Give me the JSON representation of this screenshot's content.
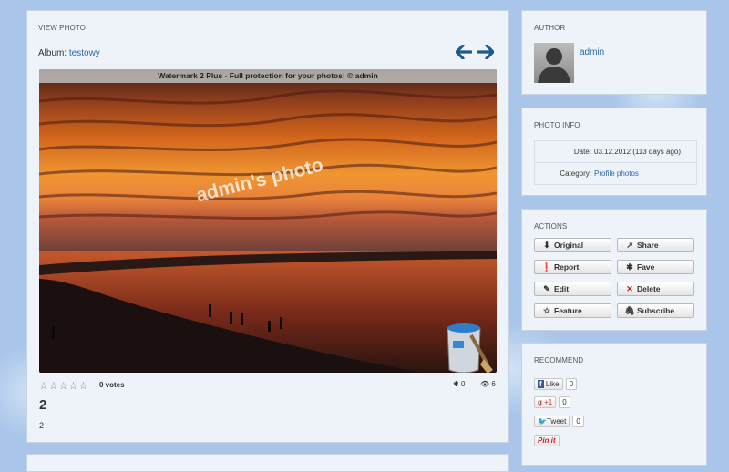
{
  "main": {
    "section_title": "VIEW PHOTO",
    "album_label": "Album:",
    "album_name": "testowy",
    "watermark_bar": "Watermark 2 Plus - Full protection for your photos!  ©  admin",
    "watermark_text": "admin's photo",
    "rating_stars": "☆☆☆☆☆",
    "votes": "0 votes",
    "faves_count": "0",
    "views_count": "6",
    "photo_title": "2",
    "photo_description": "2"
  },
  "author": {
    "section_title": "AUTHOR",
    "name": "admin"
  },
  "info": {
    "section_title": "PHOTO INFO",
    "date_label": "Date:",
    "date_value": "03.12.2012 (113 days ago)",
    "category_label": "Category:",
    "category_value": "Profile photos"
  },
  "actions": {
    "section_title": "ACTIONS",
    "original": "Original",
    "share": "Share",
    "report": "Report",
    "fave": "Fave",
    "edit": "Edit",
    "delete": "Delete",
    "feature": "Feature",
    "subscribe": "Subscribe"
  },
  "recommend": {
    "section_title": "RECOMMEND",
    "fb_label": "Like",
    "fb_count": "0",
    "gplus_label": "+1",
    "gplus_count": "0",
    "tw_label": "Tweet",
    "tw_count": "0",
    "pin_label": "Pin it"
  },
  "colors": {
    "link": "#2a6aa8",
    "arrow": "#1d5a8f",
    "delete_icon": "#cc1a1a"
  }
}
